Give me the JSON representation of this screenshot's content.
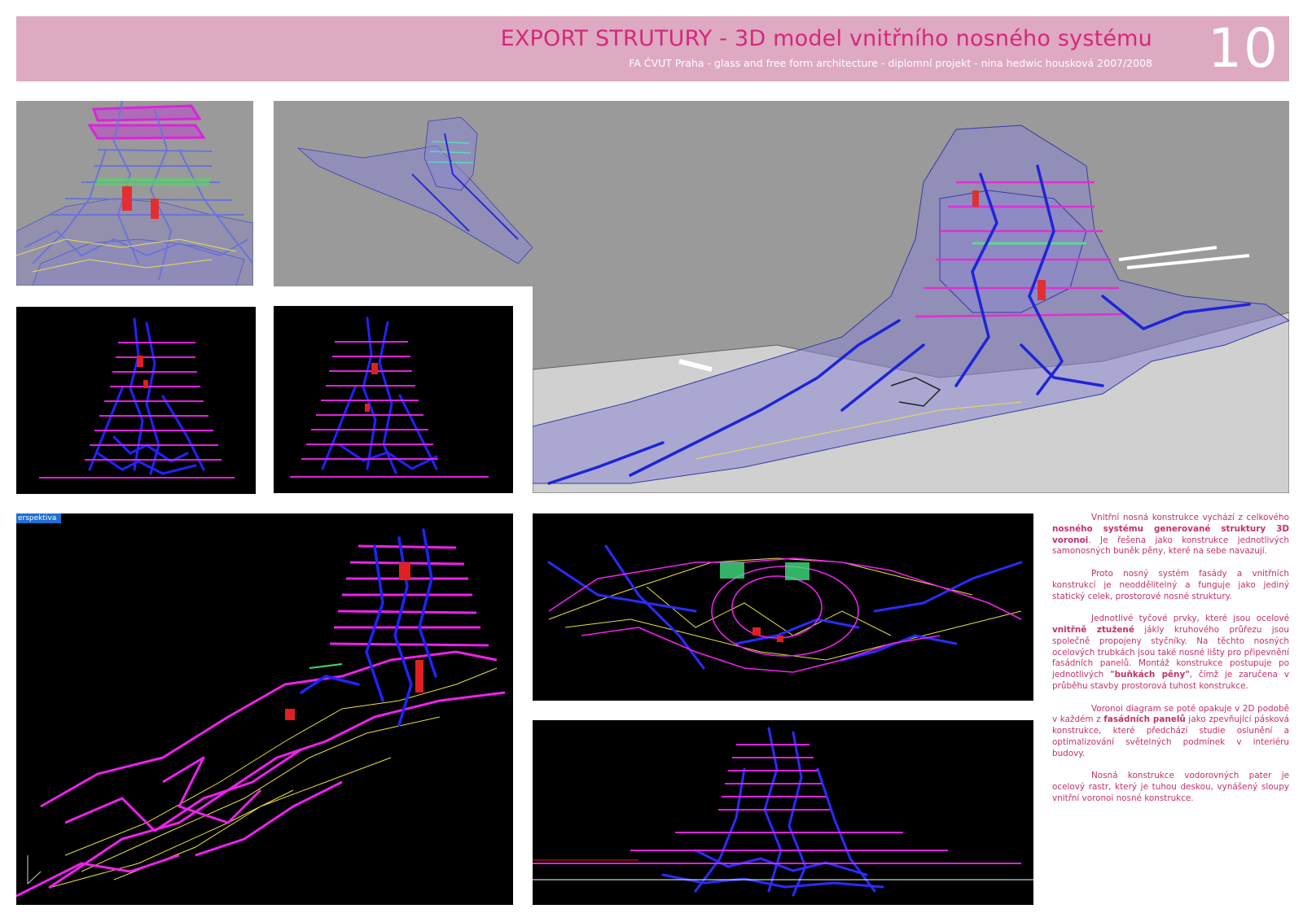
{
  "header": {
    "title": "EXPORT STRUTURY - 3D model vnitřního nosného systému",
    "subtitle": "FA ČVUT Praha - glass and free form architecture  - diplomní projekt - nina hedwic housková 2007/2008",
    "page_number": "10",
    "background_color": "#ddaac2",
    "title_color": "#d6277a"
  },
  "viewport": {
    "perspective_tab": "erspektiva"
  },
  "description": {
    "paragraphs": [
      [
        {
          "text": "Vnitřní nosná konstrukce vychází z celkového ",
          "bold": false
        },
        {
          "text": "nosného systému generované struktury 3D voronoi",
          "bold": true
        },
        {
          "text": ". Je řešena jako konstrukce jednotlivých samonosných buněk pěny, které na sebe navazují.",
          "bold": false
        }
      ],
      [
        {
          "text": "Proto nosný systém fasády a vnitřních konstrukcí je neoddělitelný a funguje jako jediný statický celek, prostorové nosné struktury.",
          "bold": false
        }
      ],
      [
        {
          "text": "Jednotlivé tyčové prvky, které jsou ocelové ",
          "bold": false
        },
        {
          "text": "vnitřně ztužené",
          "bold": true
        },
        {
          "text": " jákly kruhového průřezu jsou společně propojeny styčníky. Na těchto nosných ocelových trubkách jsou také nosné lišty pro připevnění fasádních panelů. Montáž konstrukce postupuje po jednotlivých ",
          "bold": false
        },
        {
          "text": "\"buňkách pěny\"",
          "bold": true
        },
        {
          "text": ", čímž je zaručena v průběhu stavby prostorová tuhost konstrukce.",
          "bold": false
        }
      ],
      [
        {
          "text": "Voronoi diagram se poté opakuje v 2D podobě v každém z ",
          "bold": false
        },
        {
          "text": "fasádních panelů",
          "bold": true
        },
        {
          "text": " jako zpevňující pásková konstrukce, které předchází studie oslunění a optimalizování světelných podmínek v interiéru budovy.",
          "bold": false
        }
      ],
      [
        {
          "text": "Nosná konstrukce vodorovných pater je ocelový rastr, který je tuhou deskou, vynášený sloupy vnitřní voronoi nosné konstrukce.",
          "bold": false
        }
      ]
    ],
    "text_color": "#c2316f"
  }
}
